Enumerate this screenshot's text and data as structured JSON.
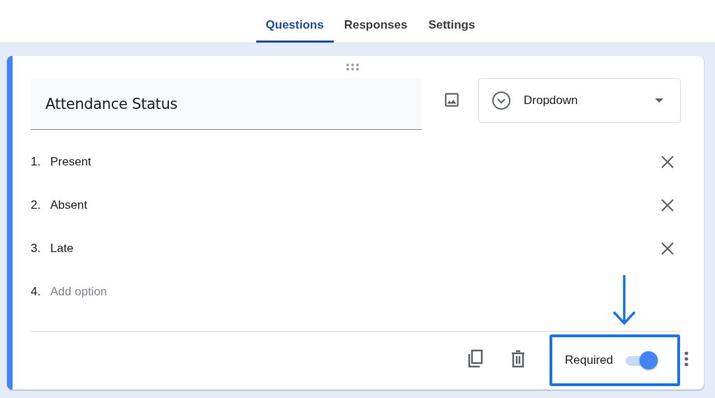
{
  "tabs": [
    {
      "label": "Questions",
      "selected": true
    },
    {
      "label": "Responses",
      "selected": false
    },
    {
      "label": "Settings",
      "selected": false
    }
  ],
  "question": {
    "title": "Attendance Status",
    "type": "Dropdown",
    "options": [
      {
        "number": "1.",
        "label": "Present",
        "kind": "option"
      },
      {
        "number": "2.",
        "label": "Absent",
        "kind": "option"
      },
      {
        "number": "3.",
        "label": "Late",
        "kind": "option"
      },
      {
        "number": "4.",
        "label": "Add option",
        "kind": "add"
      }
    ],
    "required_label": "Required",
    "required": true
  }
}
